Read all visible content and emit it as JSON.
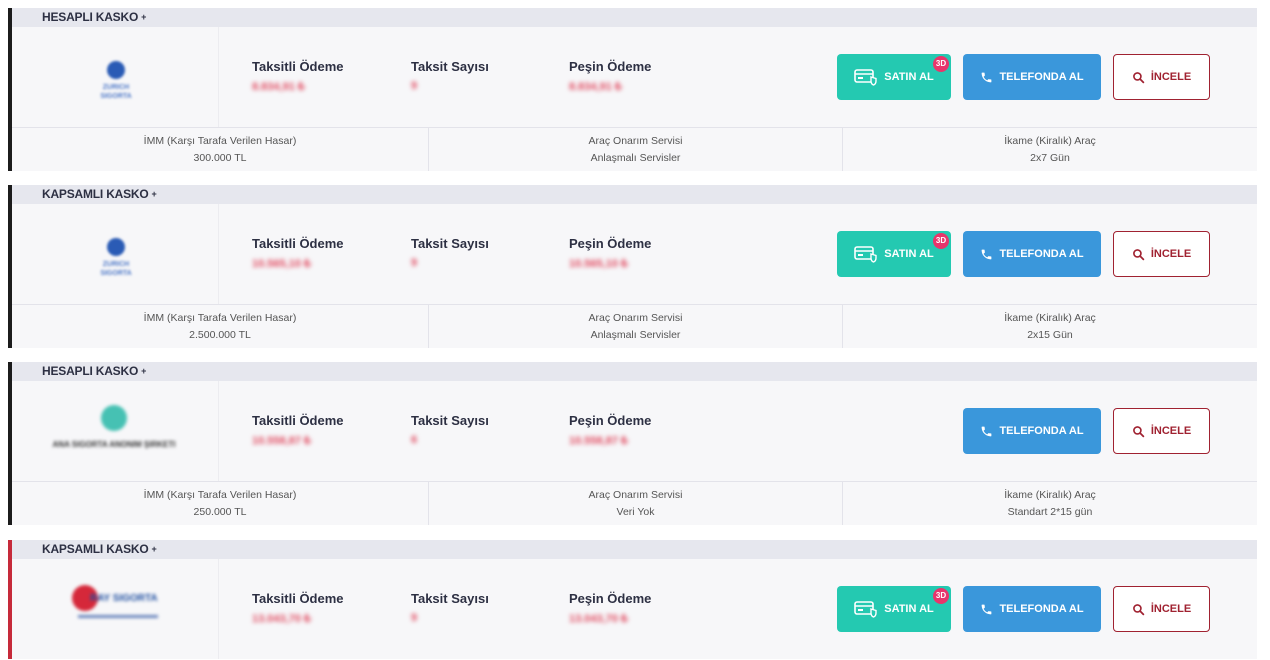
{
  "offers": [
    {
      "plan": "HESAPLI KASKO",
      "plus": "+",
      "insurer": "ZURICH SIGORTA",
      "insurer_logo": "zurich",
      "installment_label": "Taksitli Ödeme",
      "installment_value": "8.834,91 ₺",
      "count_label": "Taksit Sayısı",
      "count_value": "9",
      "cash_label": "Peşin Ödeme",
      "cash_value": "8.834,91 ₺",
      "has_buy": true,
      "buy_label": "SATIN AL",
      "badge": "3D",
      "phone_label": "TELEFONDA AL",
      "review_label": "İNCELE",
      "imm_label": "İMM (Karşı Tarafa Verilen Hasar)",
      "imm_value": "300.000 TL",
      "service_label": "Araç Onarım Servisi",
      "service_value": "Anlaşmalı Servisler",
      "rental_label": "İkame (Kiralık) Araç",
      "rental_value": "2x7 Gün",
      "accent": "#1c1c1c"
    },
    {
      "plan": "KAPSAMLI KASKO",
      "plus": "+",
      "insurer": "ZURICH SIGORTA",
      "insurer_logo": "zurich",
      "installment_label": "Taksitli Ödeme",
      "installment_value": "10.565,10 ₺",
      "count_label": "Taksit Sayısı",
      "count_value": "9",
      "cash_label": "Peşin Ödeme",
      "cash_value": "10.565,10 ₺",
      "has_buy": true,
      "buy_label": "SATIN AL",
      "badge": "3D",
      "phone_label": "TELEFONDA AL",
      "review_label": "İNCELE",
      "imm_label": "İMM (Karşı Tarafa Verilen Hasar)",
      "imm_value": "2.500.000 TL",
      "service_label": "Araç Onarım Servisi",
      "service_value": "Anlaşmalı Servisler",
      "rental_label": "İkame (Kiralık) Araç",
      "rental_value": "2x15 Gün",
      "accent": "#1c1c1c"
    },
    {
      "plan": "HESAPLI KASKO",
      "plus": "+",
      "insurer": "ANA SIGORTA ANONIM ŞIRKETI",
      "insurer_logo": "ana",
      "installment_label": "Taksitli Ödeme",
      "installment_value": "10.558,87 ₺",
      "count_label": "Taksit Sayısı",
      "count_value": "6",
      "cash_label": "Peşin Ödeme",
      "cash_value": "10.558,87 ₺",
      "has_buy": false,
      "buy_label": "",
      "badge": "",
      "phone_label": "TELEFONDA AL",
      "review_label": "İNCELE",
      "imm_label": "İMM (Karşı Tarafa Verilen Hasar)",
      "imm_value": "250.000 TL",
      "service_label": "Araç Onarım Servisi",
      "service_value": "Veri Yok",
      "rental_label": "İkame (Kiralık) Araç",
      "rental_value": "Standart 2*15 gün",
      "accent": "#1c1c1c"
    },
    {
      "plan": "KAPSAMLI KASKO",
      "plus": "+",
      "insurer": "RAY SIGORTA",
      "insurer_logo": "ray",
      "installment_label": "Taksitli Ödeme",
      "installment_value": "13.043,70 ₺",
      "count_label": "Taksit Sayısı",
      "count_value": "9",
      "cash_label": "Peşin Ödeme",
      "cash_value": "13.043,70 ₺",
      "has_buy": true,
      "buy_label": "SATIN AL",
      "badge": "3D",
      "phone_label": "TELEFONDA AL",
      "review_label": "İNCELE",
      "imm_label": "",
      "imm_value": "",
      "service_label": "",
      "service_value": "",
      "rental_label": "",
      "rental_value": "",
      "accent": "#c62a3a"
    }
  ],
  "colors": {
    "buy": "#24c9b1",
    "phone": "#3a97db",
    "review": "#a02231",
    "badge": "#e8356b",
    "header_bg": "#e6e7ee"
  }
}
